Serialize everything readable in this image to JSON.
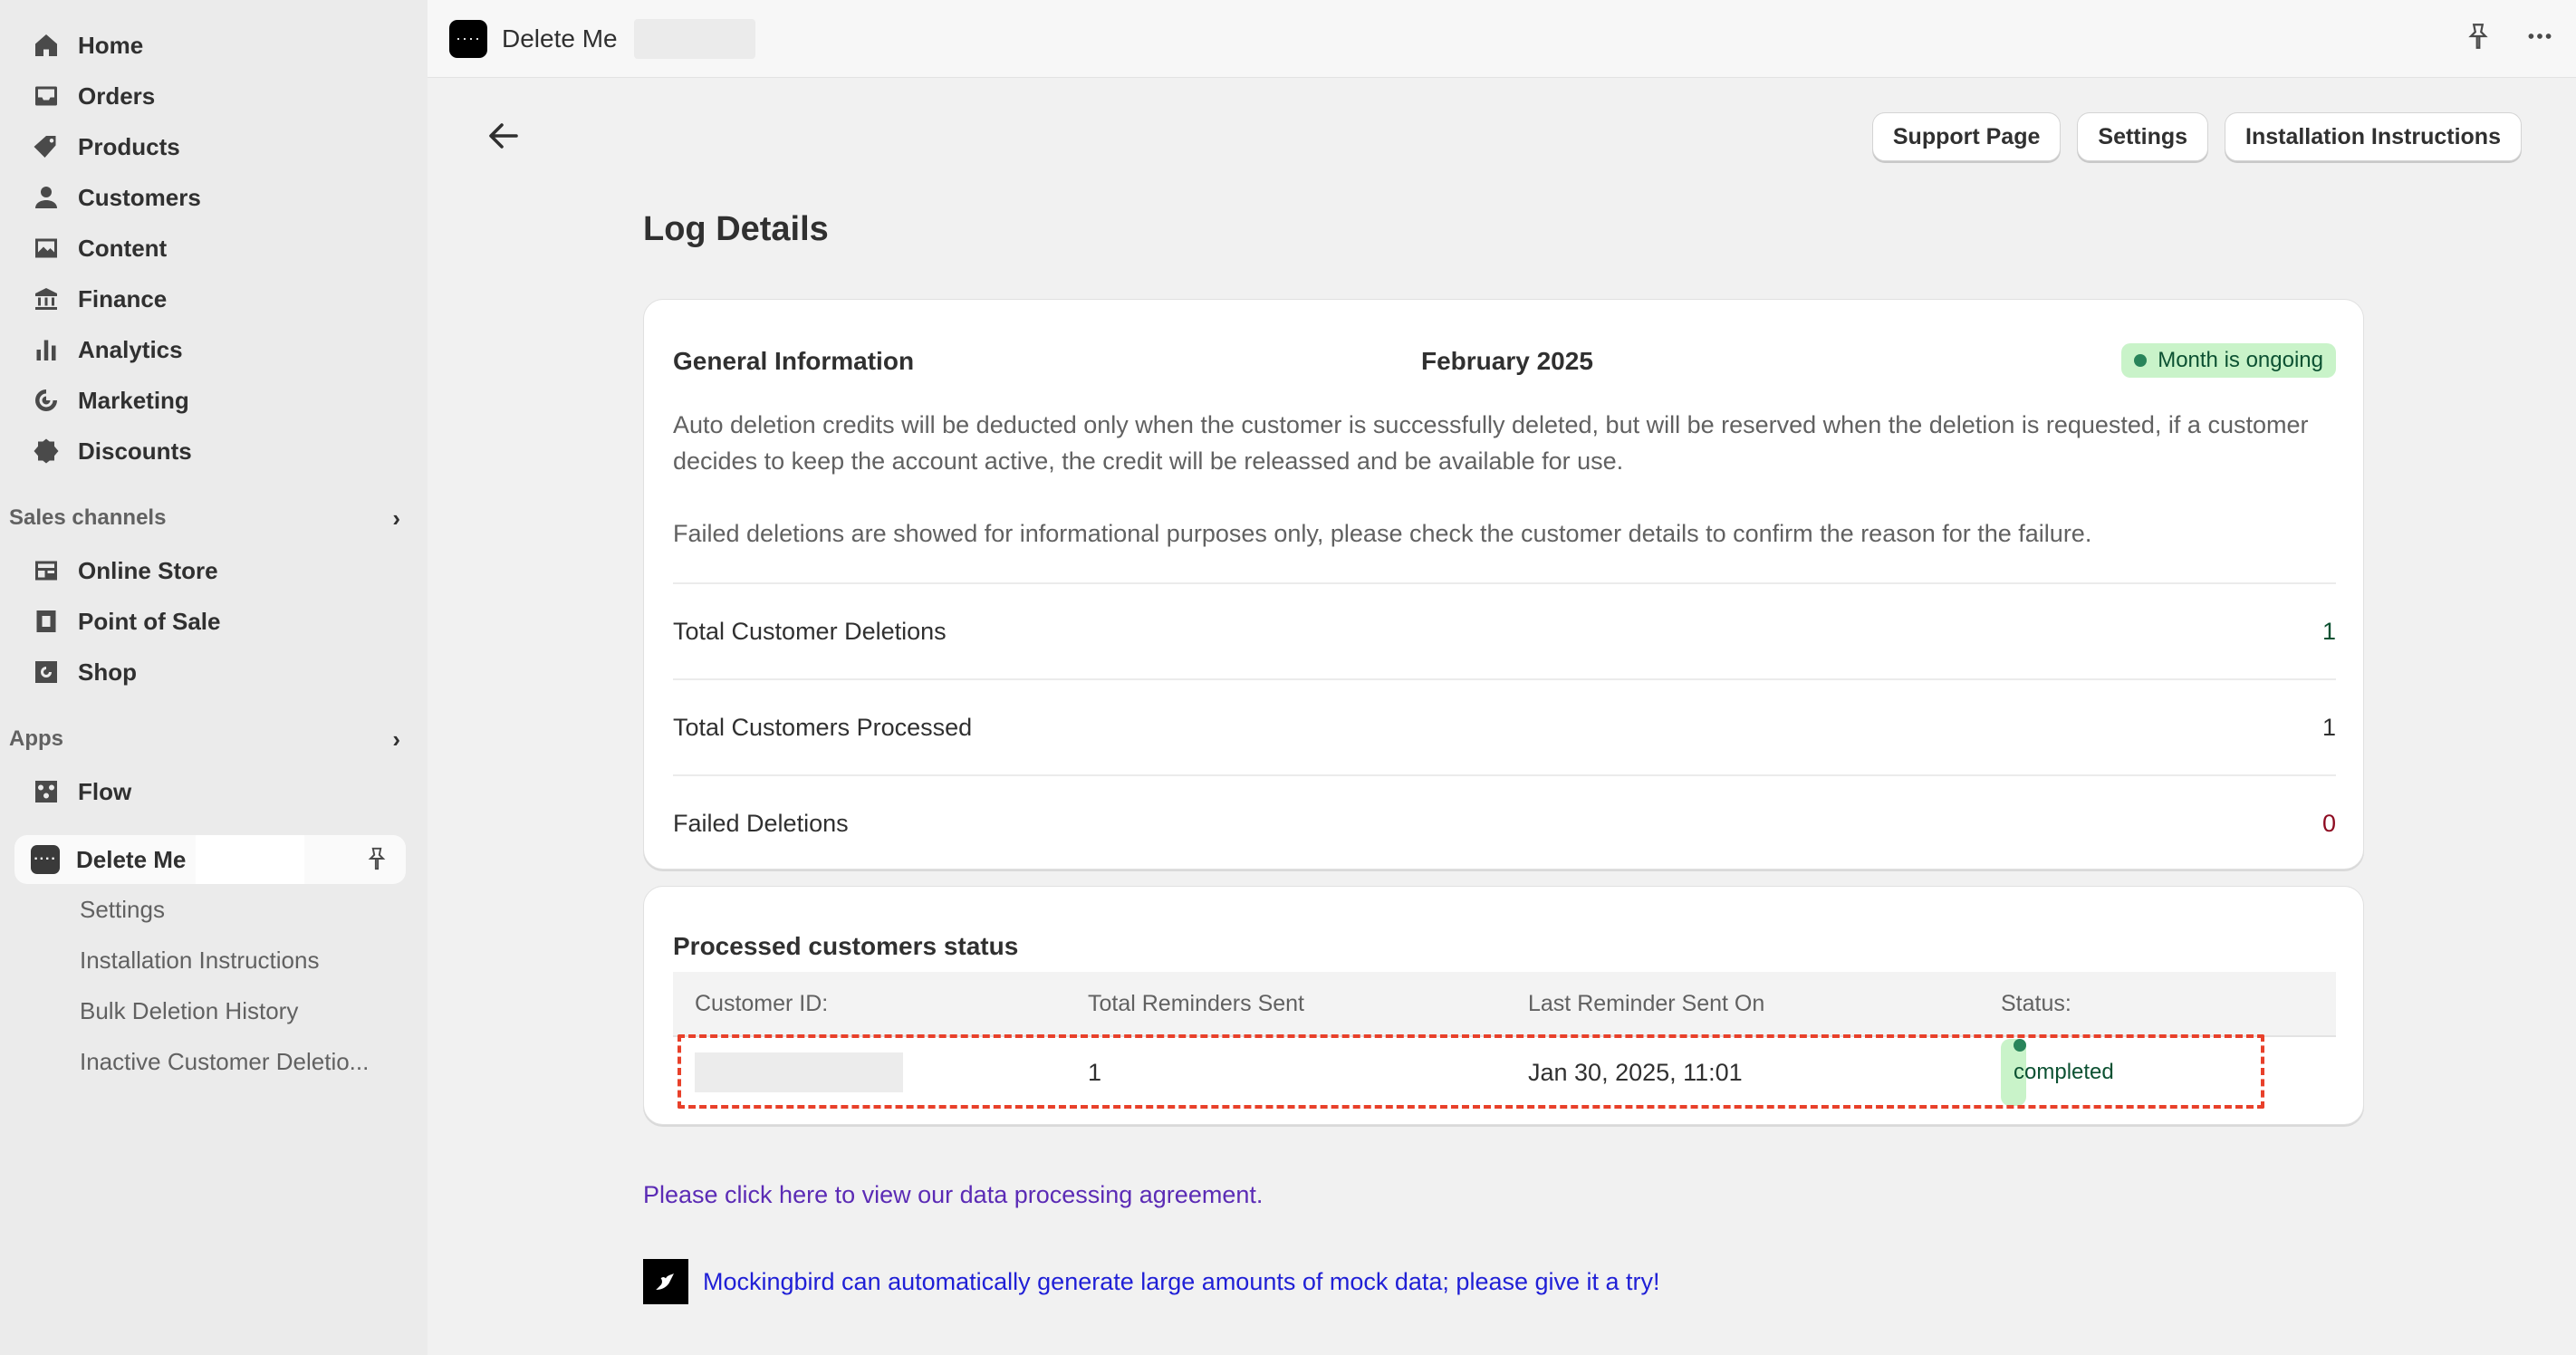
{
  "sidebar": {
    "items": [
      {
        "label": "Home",
        "icon": "home-icon"
      },
      {
        "label": "Orders",
        "icon": "inbox-icon"
      },
      {
        "label": "Products",
        "icon": "tag-icon"
      },
      {
        "label": "Customers",
        "icon": "person-icon"
      },
      {
        "label": "Content",
        "icon": "image-icon"
      },
      {
        "label": "Finance",
        "icon": "bank-icon"
      },
      {
        "label": "Analytics",
        "icon": "bar-chart-icon"
      },
      {
        "label": "Marketing",
        "icon": "target-icon"
      },
      {
        "label": "Discounts",
        "icon": "discount-icon"
      }
    ],
    "sales_channels_label": "Sales channels",
    "sales_channels": [
      {
        "label": "Online Store",
        "icon": "store-icon"
      },
      {
        "label": "Point of Sale",
        "icon": "pos-icon"
      },
      {
        "label": "Shop",
        "icon": "shop-icon"
      }
    ],
    "apps_label": "Apps",
    "apps": [
      {
        "label": "Flow",
        "icon": "flow-icon"
      }
    ],
    "active_app": {
      "label": "Delete Me",
      "sub_items": [
        "Settings",
        "Installation Instructions",
        "Bulk Deletion History",
        "Inactive Customer Deletio..."
      ]
    }
  },
  "topbar": {
    "app_title": "Delete Me"
  },
  "header_buttons": {
    "support": "Support Page",
    "settings": "Settings",
    "installation": "Installation Instructions"
  },
  "page": {
    "title": "Log Details"
  },
  "general_info": {
    "heading": "General Information",
    "month": "February 2025",
    "badge": "Month is ongoing",
    "paragraph1": "Auto deletion credits will be deducted only when the customer is successfully deleted, but will be reserved when the deletion is requested, if a customer decides to keep the account active, the credit will be releassed and be available for use.",
    "paragraph2": "Failed deletions are showed for informational purposes only, please check the customer details to confirm the reason for the failure.",
    "stats": [
      {
        "label": "Total Customer Deletions",
        "value": "1"
      },
      {
        "label": "Total Customers Processed",
        "value": "1"
      },
      {
        "label": "Failed Deletions",
        "value": "0"
      }
    ]
  },
  "processed": {
    "heading": "Processed customers status",
    "columns": [
      "Customer ID:",
      "Total Reminders Sent",
      "Last Reminder Sent On",
      "Status:"
    ],
    "rows": [
      {
        "customer_id": "",
        "reminders": "1",
        "last_sent": "Jan 30, 2025, 11:01",
        "status": "completed"
      }
    ]
  },
  "footer": {
    "dpa_link": "Please click here to view our data processing agreement.",
    "mockingbird": "Mockingbird can automatically generate large amounts of mock data; please give it a try!"
  },
  "colors": {
    "success_bg": "#c9f3c9",
    "success_text": "#0c5132",
    "critical": "#8e0b21",
    "highlight": "#e8402a"
  }
}
